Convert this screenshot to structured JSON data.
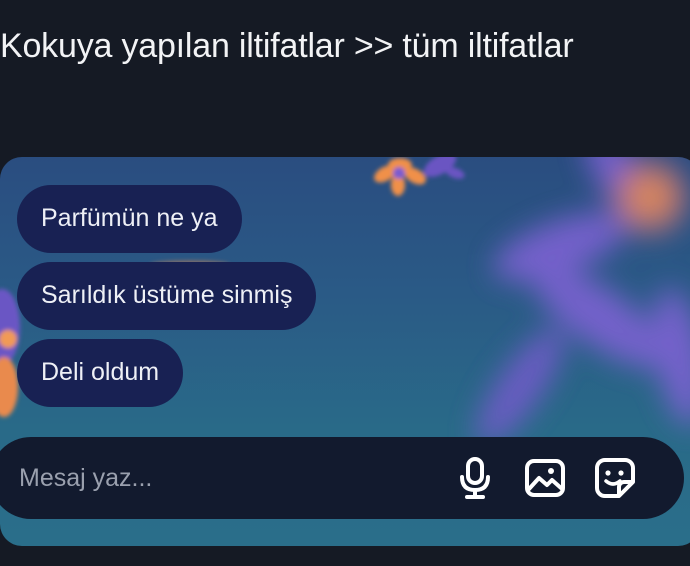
{
  "caption": {
    "text": "Kokuya yapılan iltifatlar >>  tüm iltifatlar"
  },
  "chat": {
    "messages": [
      {
        "text": "Parfümün ne ya"
      },
      {
        "text": "Sarıldık üstüme sinmiş"
      },
      {
        "text": "Deli oldum"
      }
    ]
  },
  "composer": {
    "placeholder": "Mesaj yaz...",
    "icons": [
      "microphone-icon",
      "image-icon",
      "sticker-icon"
    ]
  },
  "colors": {
    "background": "#151a24",
    "bubble": "#182153",
    "composer": "#121a2e",
    "wallpaper_top": "#2a4d80",
    "wallpaper_bottom": "#2a6e8a",
    "flower_purple": "#7a5bd0",
    "flower_orange": "#f08a4b"
  }
}
